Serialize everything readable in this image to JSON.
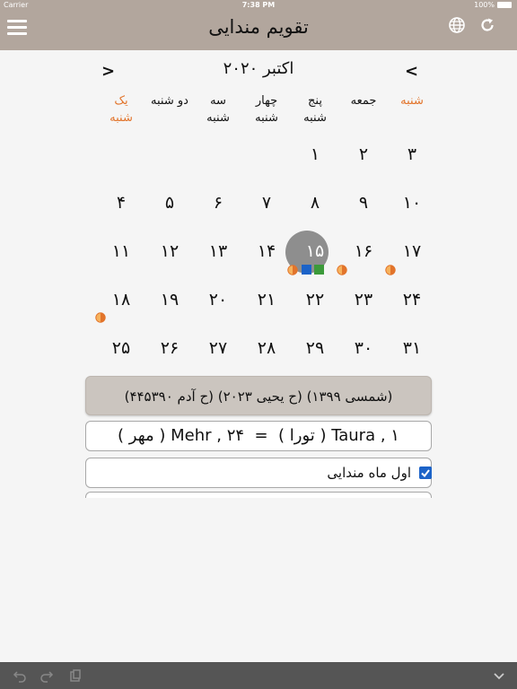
{
  "status": {
    "carrier": "Carrier",
    "time": "7:38 PM",
    "battery": "100%"
  },
  "header": {
    "title": "تقویم مندایی"
  },
  "calendar": {
    "month_label": "اکتبر ۲۰۲۰",
    "weekdays": [
      {
        "line1": "شنبه",
        "line2": "",
        "weekend": true
      },
      {
        "line1": "جمعه",
        "line2": "",
        "weekend": false
      },
      {
        "line1": "پنج",
        "line2": "شنبه",
        "weekend": false
      },
      {
        "line1": "چهار",
        "line2": "شنبه",
        "weekend": false
      },
      {
        "line1": "سه",
        "line2": "شنبه",
        "weekend": false
      },
      {
        "line1": "دو شنبه",
        "line2": "",
        "weekend": false
      },
      {
        "line1": "یک",
        "line2": "شنبه",
        "weekend": true
      }
    ],
    "weeks": [
      [
        "۳",
        "۲",
        "۱",
        "",
        "",
        "",
        ""
      ],
      [
        "۱۰",
        "۹",
        "۸",
        "۷",
        "۶",
        "۵",
        "۴"
      ],
      [
        "۱۷",
        "۱۶",
        "۱۵",
        "۱۴",
        "۱۳",
        "۱۲",
        "۱۱"
      ],
      [
        "۲۴",
        "۲۳",
        "۲۲",
        "۲۱",
        "۲۰",
        "۱۹",
        "۱۸"
      ],
      [
        "۳۱",
        "۳۰",
        "۲۹",
        "۲۸",
        "۲۷",
        "۲۶",
        "۲۵"
      ]
    ],
    "today": "۱۵"
  },
  "info": {
    "text": "(شمسی ۱۳۹۹) (ح یحیی ۲۰۲۳) (ح آدم ۴۴۵۳۹۰)"
  },
  "conversion": {
    "text": "( مهر ) Mehr , ۲۴  =  ( تورا ) Taura , ۱"
  },
  "option": {
    "label": "اول ماه مندایی",
    "checked": true
  },
  "colors": {
    "header_bg": "#b2a69d",
    "weekend": "#e2742b",
    "today_bg": "#8e8e8e",
    "check": "#1c63c8"
  }
}
